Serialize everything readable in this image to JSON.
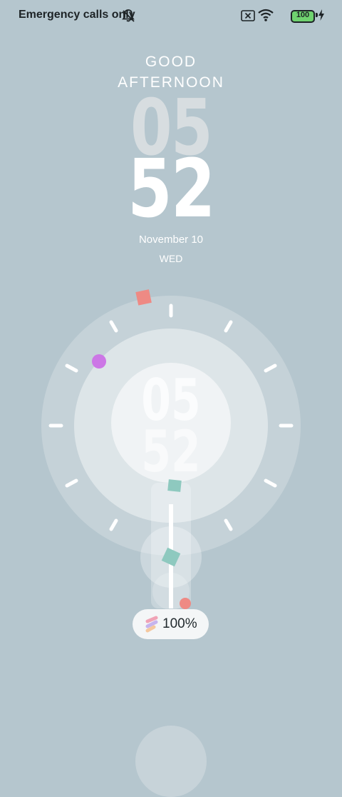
{
  "status_bar": {
    "carrier": "Emergency calls only",
    "battery_level": "100"
  },
  "greeting": {
    "line1": "GOOD",
    "line2": "AFTERNOON"
  },
  "clock": {
    "hour": "05",
    "minute": "52"
  },
  "date": {
    "date": "November 10",
    "weekday": "WED"
  },
  "charging": {
    "percent": "100%"
  },
  "colors": {
    "background": "#b5c6ce",
    "accent_red": "#ee8a84",
    "accent_purple": "#cc77e6",
    "accent_teal": "#8ec9bf",
    "battery_green": "#6fd26f"
  },
  "icons": [
    "bell-off-icon",
    "sim-icon",
    "wifi-icon",
    "battery-icon",
    "charging-bolt-icon",
    "charging-plug-icon"
  ]
}
